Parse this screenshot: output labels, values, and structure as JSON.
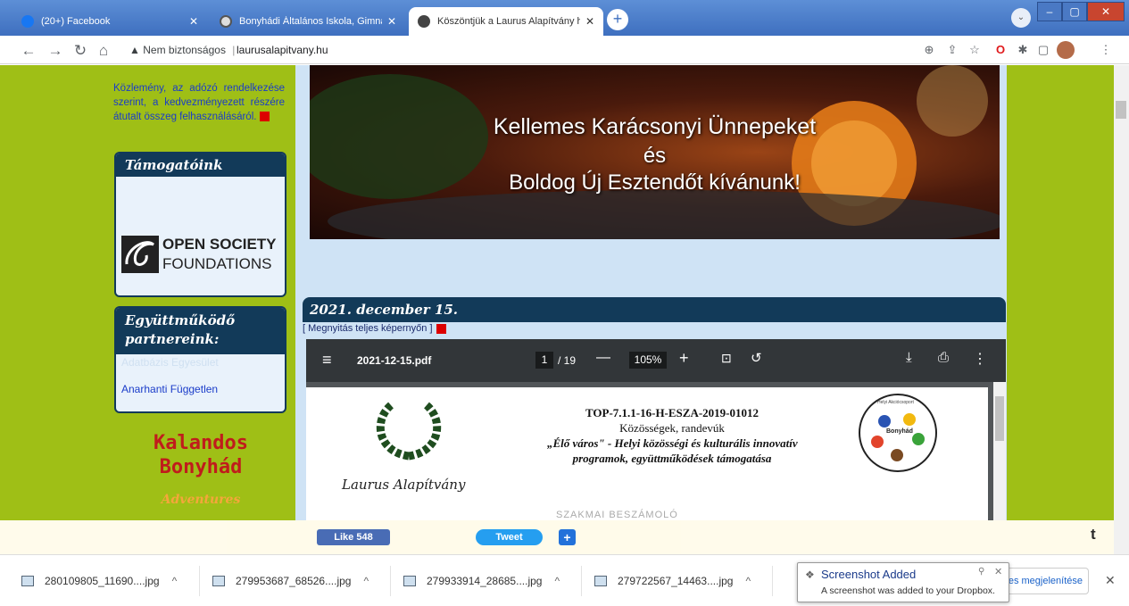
{
  "tabs": [
    {
      "label": "(20+) Facebook",
      "active": false,
      "icon": "facebook-icon",
      "color": "#1877f2"
    },
    {
      "label": "Bonyhádi Általános Iskola, Gimná",
      "active": false,
      "icon": "globe-icon",
      "color": "#555555"
    },
    {
      "label": "Köszöntjük a Laurus Alapítvány h",
      "active": true,
      "icon": "site-icon",
      "color": "#333333"
    }
  ],
  "new_tab": "+",
  "window_buttons": {
    "minimize": "–",
    "maximize": "▢",
    "close": "✕"
  },
  "addressbar": {
    "security_label": "Nem biztonságos",
    "url": "laurusalapitvany.hu"
  },
  "sidebar": {
    "notice": "Közlemény, az adózó rendelkezése szerint, a kedvezményezett részére átutalt összeg felhasználásáról.",
    "supporters_title": "Támogatóink",
    "osf_line1": "OPEN SOCIETY",
    "osf_line2": "FOUNDATIONS",
    "partners_title": "Együttműködő partnereink:",
    "partner_faded": "Adatbázis Egyesület",
    "partner_item": "Anarhanti Független",
    "kalandos_line1": "Kalandos",
    "kalandos_line2": "Bonyhád",
    "adventures": "Adventures"
  },
  "banner": {
    "line1": "Kellemes Karácsonyi Ünnepeket",
    "line2": "és",
    "line3": "Boldog Új Esztendőt kívánunk!"
  },
  "post": {
    "date": "2021. december 15.",
    "fullscreen_link": "[ Megnyitás teljes képernyőn ]"
  },
  "pdf_viewer": {
    "filename": "2021-12-15.pdf",
    "page_current": "1",
    "page_total": "/ 19",
    "zoom": "105%",
    "doc_code": "TOP-7.1.1-16-H-ESZA-2019-01012",
    "doc_subtitle": "Közösségek, randevúk",
    "doc_title_1": "„Élő város\" - Helyi közösségi és kulturális innovatív",
    "doc_title_2": "programok, együttműködések támogatása",
    "laurus_signature": "Laurus Alapítvány",
    "right_logo_text": "Bonyhád",
    "right_logo_arc": "Helyi Akciócsoport",
    "hidden_heading": "SZAKMAI BESZÁMOLÓ"
  },
  "social": {
    "like_label": "Like 548",
    "tweet_label": "Tweet",
    "plus_label": "+",
    "t_label": "t"
  },
  "downloads": [
    {
      "name": "280109805_11690....jpg"
    },
    {
      "name": "279953687_68526....jpg"
    },
    {
      "name": "279933914_28685....jpg"
    },
    {
      "name": "279722567_14463....jpg"
    }
  ],
  "downloads_show_all": "Az összes megjelenítése",
  "toast": {
    "title": "Screenshot Added",
    "body": "A screenshot was added to your Dropbox."
  },
  "colors": {
    "page_bg": "#9fbf16",
    "box_head": "#123a59",
    "content_bg": "#cfe3f5",
    "pdf_toolbar": "#323639"
  }
}
